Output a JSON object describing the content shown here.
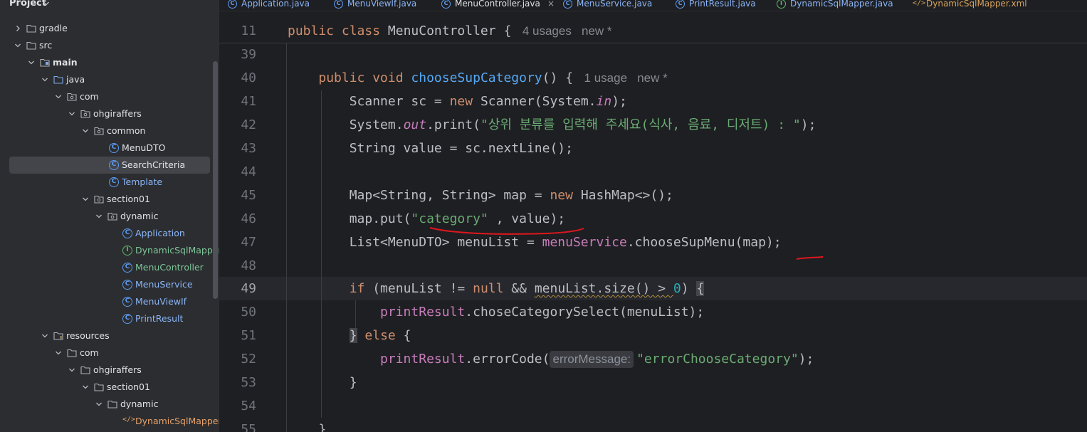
{
  "project": {
    "title": "Project",
    "tree": [
      {
        "label": "gradle",
        "level": 0,
        "kind": "folder",
        "state": "collapsed"
      },
      {
        "label": "src",
        "level": 0,
        "kind": "folder",
        "state": "expanded"
      },
      {
        "label": "main",
        "level": 1,
        "kind": "folder-module",
        "state": "expanded",
        "bold": true
      },
      {
        "label": "java",
        "level": 2,
        "kind": "folder-source",
        "state": "expanded"
      },
      {
        "label": "com",
        "level": 3,
        "kind": "package",
        "state": "expanded"
      },
      {
        "label": "ohgiraffers",
        "level": 4,
        "kind": "package",
        "state": "expanded"
      },
      {
        "label": "common",
        "level": 5,
        "kind": "package",
        "state": "expanded"
      },
      {
        "label": "MenuDTO",
        "level": 7,
        "kind": "class",
        "color": "white"
      },
      {
        "label": "SearchCriteria",
        "level": 7,
        "kind": "class",
        "color": "white",
        "selected": true
      },
      {
        "label": "Template",
        "level": 7,
        "kind": "class",
        "color": "blue"
      },
      {
        "label": "section01",
        "level": 5,
        "kind": "package",
        "state": "expanded"
      },
      {
        "label": "dynamic",
        "level": 6,
        "kind": "package",
        "state": "expanded"
      },
      {
        "label": "Application",
        "level": 8,
        "kind": "class-main",
        "color": "blue"
      },
      {
        "label": "DynamicSqlMapper",
        "level": 8,
        "kind": "interface",
        "color": "green"
      },
      {
        "label": "MenuController",
        "level": 8,
        "kind": "class",
        "color": "green"
      },
      {
        "label": "MenuService",
        "level": 8,
        "kind": "class",
        "color": "blue"
      },
      {
        "label": "MenuViewIf",
        "level": 8,
        "kind": "class",
        "color": "blue"
      },
      {
        "label": "PrintResult",
        "level": 8,
        "kind": "class",
        "color": "blue"
      },
      {
        "label": "resources",
        "level": 2,
        "kind": "folder-resources",
        "state": "expanded"
      },
      {
        "label": "com",
        "level": 3,
        "kind": "folder",
        "state": "expanded"
      },
      {
        "label": "ohgiraffers",
        "level": 4,
        "kind": "folder",
        "state": "expanded"
      },
      {
        "label": "section01",
        "level": 5,
        "kind": "folder",
        "state": "expanded"
      },
      {
        "label": "dynamic",
        "level": 6,
        "kind": "folder",
        "state": "expanded"
      },
      {
        "label": "DynamicSqlMapper.xml",
        "level": 8,
        "kind": "xml",
        "color": "orange"
      }
    ]
  },
  "tabs": [
    {
      "label": "Application.java",
      "icon": "class-icon"
    },
    {
      "label": "MenuViewIf.java",
      "icon": "class-icon"
    },
    {
      "label": "MenuController.java",
      "icon": "class-icon",
      "active": true,
      "close": "×"
    },
    {
      "label": "MenuService.java",
      "icon": "class-icon"
    },
    {
      "label": "PrintResult.java",
      "icon": "class-icon"
    },
    {
      "label": "DynamicSqlMapper.java",
      "icon": "interface-icon"
    },
    {
      "label": "DynamicSqlMapper.xml",
      "icon": "xml-icon"
    }
  ],
  "editor": {
    "current_line": "49",
    "lines": [
      {
        "num": "11",
        "tokens": [
          [
            "kw",
            "public class "
          ],
          [
            "",
            "MenuController { "
          ],
          [
            "hint",
            " 4 usages   new *"
          ]
        ]
      },
      {
        "num": "39",
        "tokens": []
      },
      {
        "num": "40",
        "tokens": [
          [
            "",
            "    "
          ],
          [
            "kw",
            "public void "
          ],
          [
            "fn",
            "chooseSupCategory"
          ],
          [
            "",
            "() { "
          ],
          [
            "hint",
            " 1 usage   new *"
          ]
        ]
      },
      {
        "num": "41",
        "tokens": [
          [
            "",
            "        Scanner sc = "
          ],
          [
            "kw",
            "new "
          ],
          [
            "",
            "Scanner(System."
          ],
          [
            "stat",
            "in"
          ],
          [
            "",
            ");"
          ]
        ]
      },
      {
        "num": "42",
        "tokens": [
          [
            "",
            "        System."
          ],
          [
            "stat",
            "out"
          ],
          [
            "",
            ".print("
          ],
          [
            "str",
            "\"상위 분류를 입력해 주세요(식사, 음료, 디저트) : \""
          ],
          [
            "",
            ");"
          ]
        ]
      },
      {
        "num": "43",
        "tokens": [
          [
            "",
            "        String value = sc.nextLine();"
          ]
        ]
      },
      {
        "num": "44",
        "tokens": []
      },
      {
        "num": "45",
        "tokens": [
          [
            "",
            "        Map<String, String> map = "
          ],
          [
            "kw",
            "new "
          ],
          [
            "",
            "HashMap<>();"
          ]
        ]
      },
      {
        "num": "46",
        "tokens": [
          [
            "",
            "        map.put("
          ],
          [
            "str",
            "\"category\""
          ],
          [
            "",
            " , value);"
          ]
        ]
      },
      {
        "num": "47",
        "tokens": [
          [
            "",
            "        List<MenuDTO> menuList = "
          ],
          [
            "fld",
            "menuService"
          ],
          [
            "",
            ".chooseSupMenu(map);"
          ]
        ]
      },
      {
        "num": "48",
        "tokens": []
      },
      {
        "num": "49",
        "tokens": [
          [
            "",
            "        "
          ],
          [
            "kw",
            "if "
          ],
          [
            "",
            "(menuList != "
          ],
          [
            "kw",
            "null "
          ],
          [
            "",
            "&& "
          ],
          [
            "warn",
            "menuList.size() > "
          ],
          [
            "num",
            "0"
          ],
          [
            "",
            ") "
          ],
          [
            "brace",
            "{"
          ]
        ]
      },
      {
        "num": "50",
        "tokens": [
          [
            "",
            "            "
          ],
          [
            "fld",
            "printResult"
          ],
          [
            "",
            ".choseCategorySelect(menuList);"
          ]
        ]
      },
      {
        "num": "51",
        "tokens": [
          [
            "",
            "        "
          ],
          [
            "brace",
            "}"
          ],
          [
            "",
            " "
          ],
          [
            "kw",
            "else "
          ],
          [
            "",
            "{"
          ]
        ]
      },
      {
        "num": "52",
        "tokens": [
          [
            "",
            "            "
          ],
          [
            "fld",
            "printResult"
          ],
          [
            "",
            ".errorCode("
          ],
          [
            "param",
            "errorMessage:"
          ],
          [
            "str",
            "\"errorChooseCategory\""
          ],
          [
            "",
            ");"
          ]
        ]
      },
      {
        "num": "53",
        "tokens": [
          [
            "",
            "        }"
          ]
        ]
      },
      {
        "num": "54",
        "tokens": []
      },
      {
        "num": "55",
        "tokens": [
          [
            "",
            "    }"
          ]
        ]
      }
    ]
  },
  "colors": {
    "keyword": "#cf8e6d",
    "method": "#56a8f5",
    "string": "#6aab73",
    "field": "#c77dbb",
    "number": "#2aacb8",
    "annotation_mark": "#e0161e"
  }
}
